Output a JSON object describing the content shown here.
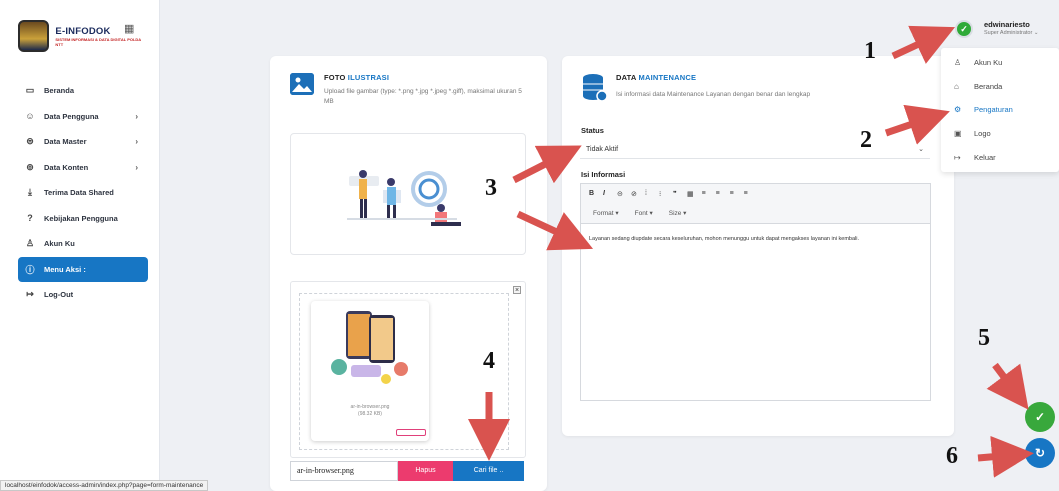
{
  "sidebar": {
    "logo_title": "E-INFODOK",
    "logo_sub": "SISTEM INFORMASI & DATA DIGITAL POLDA NTT",
    "items": [
      {
        "icon": "monitor-icon",
        "glyph": "▭",
        "label": "Beranda",
        "chevron": ""
      },
      {
        "icon": "users-icon",
        "glyph": "☺",
        "label": "Data Pengguna",
        "chevron": "›"
      },
      {
        "icon": "database-icon",
        "glyph": "⊜",
        "label": "Data Master",
        "chevron": "›"
      },
      {
        "icon": "layers-icon",
        "glyph": "⊚",
        "label": "Data Konten",
        "chevron": "›"
      },
      {
        "icon": "download-icon",
        "glyph": "⤓",
        "label": "Terima Data Shared",
        "chevron": ""
      },
      {
        "icon": "help-icon",
        "glyph": "?",
        "label": "Kebijakan Pengguna",
        "chevron": ""
      },
      {
        "icon": "user-icon",
        "glyph": "♙",
        "label": "Akun Ku",
        "chevron": ""
      },
      {
        "icon": "info-icon",
        "glyph": "ⓘ",
        "label": "Menu Aksi :",
        "chevron": ""
      },
      {
        "icon": "logout-icon",
        "glyph": "↦",
        "label": "Log-Out",
        "chevron": ""
      }
    ]
  },
  "foto": {
    "title_plain": "FOTO ",
    "title_accent": "ILUSTRASI",
    "desc": "Upload file gambar (type: *.png *.jpg *.jpeg *.giff), maksimal ukuran 5 MB",
    "preview_name": "ar-in-browser.png",
    "preview_size": "(98.32 KB)",
    "file_value": "ar-in-browser.png",
    "hapus": "Hapus",
    "cari": "Cari file ..",
    "close": "×"
  },
  "maintenance": {
    "title_plain": "DATA ",
    "title_accent": "MAINTENANCE",
    "desc": "Isi informasi data Maintenance Layanan dengan benar dan lengkap",
    "status_label": "Status",
    "status_value": "Tidak Aktif",
    "info_label": "Isi Informasi",
    "toolbar_row1": [
      "B",
      "I",
      "⊝",
      "⊘",
      "⁞",
      "⁝",
      "❞",
      "▦",
      "≡",
      "≡",
      "≡",
      "≡"
    ],
    "toolbar_row2": [
      "Format  ▾",
      "Font  ▾",
      "Size  ▾"
    ],
    "content": "Layanan sedang diupdate secara keseluruhan, mohon menunggu untuk dapat mengakses layanan ini kembali."
  },
  "user": {
    "name": "edwinariesto",
    "role": "Super Administrator ⌄",
    "avatar_glyph": "✓"
  },
  "dropdown": [
    {
      "icon": "user-icon",
      "glyph": "♙",
      "label": "Akun Ku",
      "selected": false
    },
    {
      "icon": "home-icon",
      "glyph": "⌂",
      "label": "Beranda",
      "selected": false
    },
    {
      "icon": "gear-icon",
      "glyph": "⚙",
      "label": "Pengaturan",
      "selected": true
    },
    {
      "icon": "image-icon",
      "glyph": "▣",
      "label": "Logo",
      "selected": false
    },
    {
      "icon": "logout-icon",
      "glyph": "↦",
      "label": "Keluar",
      "selected": false
    }
  ],
  "fab": {
    "save_glyph": "✓",
    "reset_glyph": "↻"
  },
  "annotations": [
    "1",
    "2",
    "3",
    "4",
    "5",
    "6"
  ],
  "annotation_color": "#d9534f",
  "statusbar": "localhost/einfodok/access-admin/index.php?page=form-maintenance",
  "colors": {
    "primary": "#1776c4",
    "danger": "#ec3b6e",
    "success": "#38a83c"
  }
}
